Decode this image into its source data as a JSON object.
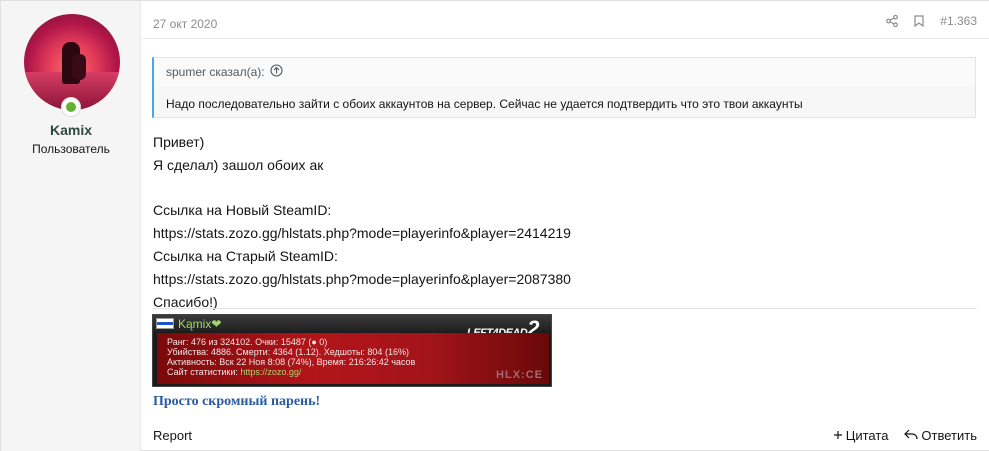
{
  "user": {
    "name": "Kamix",
    "title": "Пользователь"
  },
  "post": {
    "date": "27 окт 2020",
    "number": "#1.363"
  },
  "quote": {
    "header": "spumer сказал(а):",
    "body": "Надо последовательно зайти с обоих аккаунтов на сервер. Сейчас не удается подтвердить что это твои аккаунты"
  },
  "content": {
    "line1": "Привет)",
    "line2": "Я сделал) зашол обоих ак",
    "line3": "Ссылка на Новый SteamID:",
    "line4": "https://stats.zozo.gg/hlstats.php?mode=playerinfo&player=2414219",
    "line5": "Ссылка на Старый SteamID:",
    "line6": "https://stats.zozo.gg/hlstats.php?mode=playerinfo&player=2087380",
    "line7": "Спасибо!)"
  },
  "banner": {
    "name": "Kąmix❤",
    "rank": "Ранг: 476 из 324102. Очки: 15487 (● 0)",
    "kills": "Убийства: 4886. Смерти: 4364 (1.12). Хедшоты: 804 (16%)",
    "activity": "Активность: Вск 22 Ноя 8:08 (74%), Время: 216:26:42 часов",
    "site_label": "Сайт статистики:",
    "site_url": "https://zozo.gg/",
    "logo_text": "LEFT4DEAD",
    "logo_num": "2",
    "brand": "HLX:CE"
  },
  "signature": "Просто скромный парень!",
  "footer": {
    "report": "Report",
    "quote_label": "Цитата",
    "reply_label": "Ответить"
  }
}
